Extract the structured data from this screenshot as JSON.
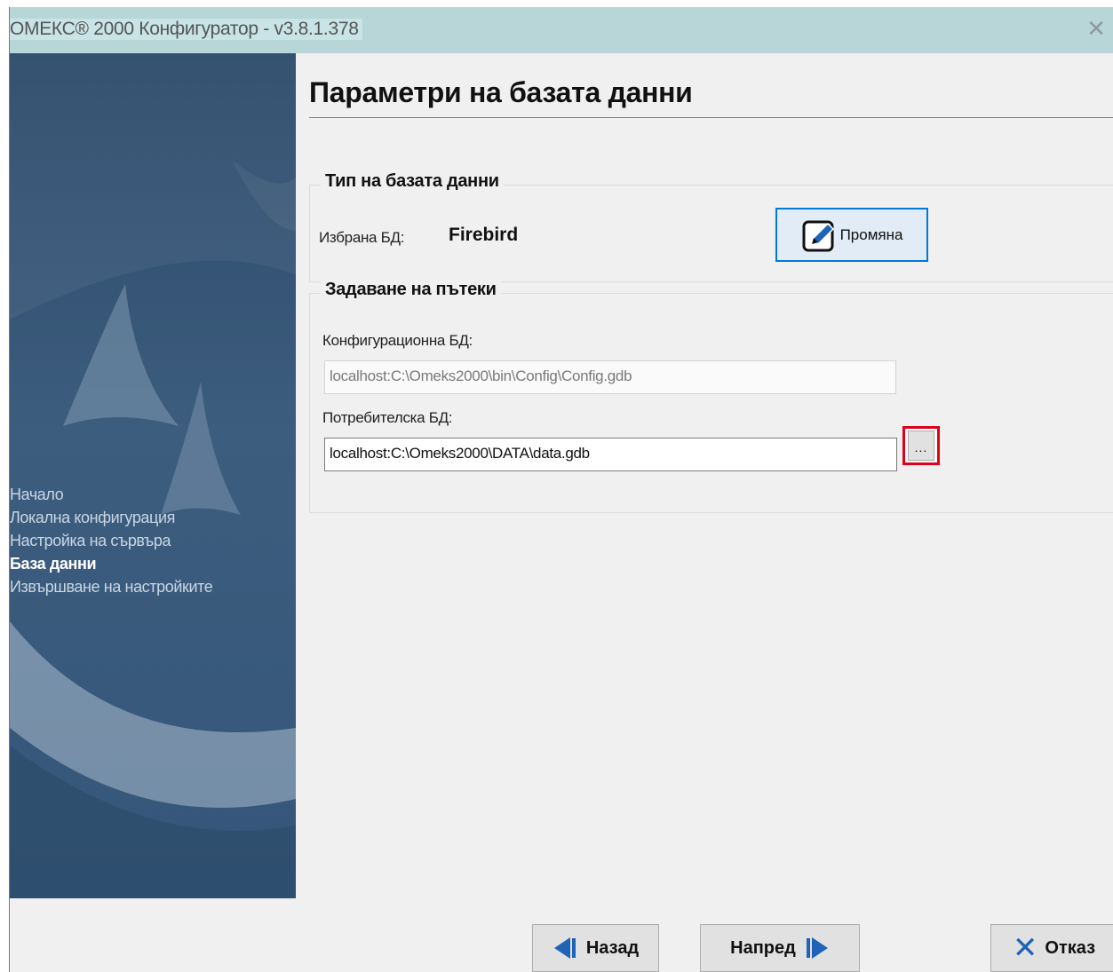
{
  "window": {
    "title": "ОМЕКС® 2000 Конфигуратор - v3.8.1.378",
    "close_icon": "close-icon"
  },
  "sidebar": {
    "items": [
      {
        "label": "Начало",
        "active": false
      },
      {
        "label": "Локална конфигурация",
        "active": false
      },
      {
        "label": "Настройка на сървъра",
        "active": false
      },
      {
        "label": "База данни",
        "active": true
      },
      {
        "label": "Извършване на настройките",
        "active": false
      }
    ]
  },
  "page": {
    "title": "Параметри на базата данни"
  },
  "db_type_group": {
    "legend": "Тип на базата данни",
    "selected_label": "Избрана БД:",
    "selected_value": "Firebird",
    "change_button_label": "Промяна",
    "change_icon": "edit-icon"
  },
  "paths_group": {
    "legend": "Задаване на пътеки",
    "config_db_label": "Конфигурационна БД:",
    "config_db_value": "localhost:C:\\Omeks2000\\bin\\Config\\Config.gdb",
    "user_db_label": "Потребителска БД:",
    "user_db_value": "localhost:C:\\Omeks2000\\DATA\\data.gdb",
    "browse_button_label": "..."
  },
  "footer": {
    "back_label": "Назад",
    "next_label": "Напред",
    "cancel_label": "Отказ"
  },
  "colors": {
    "titlebar": "#b8d6d8",
    "sidebar": "#3d5d7e",
    "accent": "#0078d7",
    "highlight_border": "#e0001a"
  }
}
